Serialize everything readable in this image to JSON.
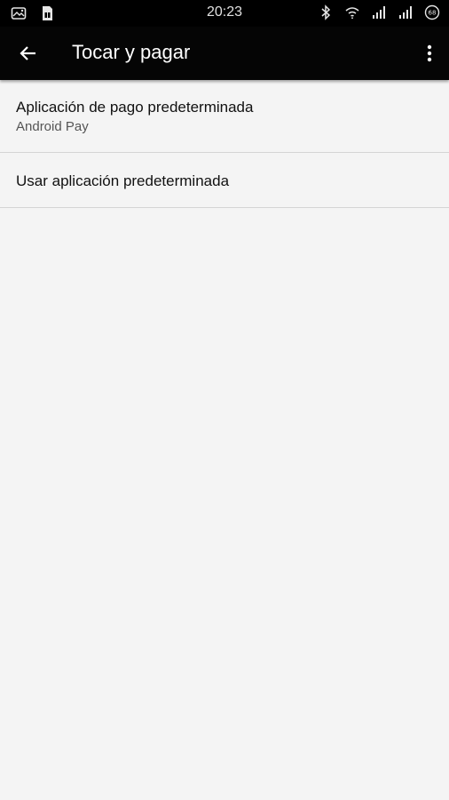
{
  "status_bar": {
    "time": "20:23",
    "left_icons": [
      "image-notification-icon",
      "sim-card-icon"
    ],
    "right_icons": [
      "bluetooth-icon",
      "wifi-icon",
      "signal-icon",
      "signal-icon",
      "battery-icon"
    ],
    "battery_level": "68"
  },
  "app_bar": {
    "title": "Tocar y pagar",
    "back_icon": "arrow-back-icon",
    "overflow_icon": "more-vert-icon"
  },
  "settings": {
    "items": [
      {
        "title": "Aplicación de pago predeterminada",
        "subtitle": "Android Pay"
      },
      {
        "title": "Usar aplicación predeterminada"
      }
    ]
  },
  "colors": {
    "status_bar_bg": "#000000",
    "app_bar_bg": "#050505",
    "background": "#f4f4f4",
    "divider": "#d4d4d4",
    "primary_text": "#111111",
    "secondary_text": "#555555"
  }
}
